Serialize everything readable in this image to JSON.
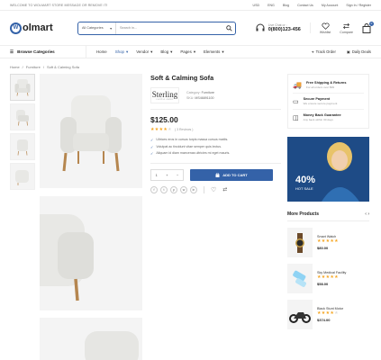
{
  "topbar": {
    "welcome": "WELCOME TO WOLMART STORE MESSAGE OR REMOVE IT!",
    "currency": "USD",
    "language": "ENG",
    "blog": "Blog",
    "contact": "Contact Us",
    "account": "My Account",
    "signin": "Sign In / Register"
  },
  "header": {
    "logo_text": "olmart",
    "search_category": "All Categories",
    "search_placeholder": "Search in...",
    "live_chat_label": "Live Chat or :",
    "phone": "0(800)123-456",
    "wishlist": "Wishlist",
    "compare": "Compare",
    "cart_count": "0"
  },
  "nav": {
    "browse": "Browse Categories",
    "items": [
      "Home",
      "Shop",
      "Vendor",
      "Blog",
      "Pages",
      "Elements"
    ],
    "track_order": "Track Order",
    "daily_deals": "Daily Deals"
  },
  "breadcrumb": [
    "Home",
    "Furniture",
    "Soft & Calming Sofa"
  ],
  "product": {
    "title": "Soft & Calming Sofa",
    "brand_name": "Sterling",
    "brand_tagline": "CAPITAL GROUP",
    "category_label": "Category:",
    "category": "Furniture",
    "sku_label": "SKU:",
    "sku": "MS46891100",
    "price": "$125.00",
    "rating": 4,
    "reviews": "( 3 Reviews )",
    "bullets": [
      "Ultrices eros in cursus turpis massa cursus mattis.",
      "Volutpat ac tincidunt vitae semper quis lectus.",
      "Aliquam id diam maecenas ultricies mi eget mauris."
    ],
    "quantity": "1",
    "add_to_cart": "ADD TO CART"
  },
  "services": [
    {
      "title": "Free Shipping & Returns",
      "sub": "For all orders over $99"
    },
    {
      "title": "Secure Payment",
      "sub": "We ensure secure payment"
    },
    {
      "title": "Money Back Guarantee",
      "sub": "Any back within 30 days"
    }
  ],
  "banner": {
    "discount": "40%",
    "label": "HOT SALE"
  },
  "more_products": {
    "heading": "More Products",
    "items": [
      {
        "name": "Smart Watch",
        "rating": 5,
        "price": "$80.00"
      },
      {
        "name": "Sky Medical Facility",
        "rating": 5,
        "price": "$58.00"
      },
      {
        "name": "Black Stunt Motor",
        "rating": 4,
        "price": "$374.00"
      }
    ]
  },
  "colors": {
    "accent": "#3462a8",
    "star": "#f5a623"
  }
}
